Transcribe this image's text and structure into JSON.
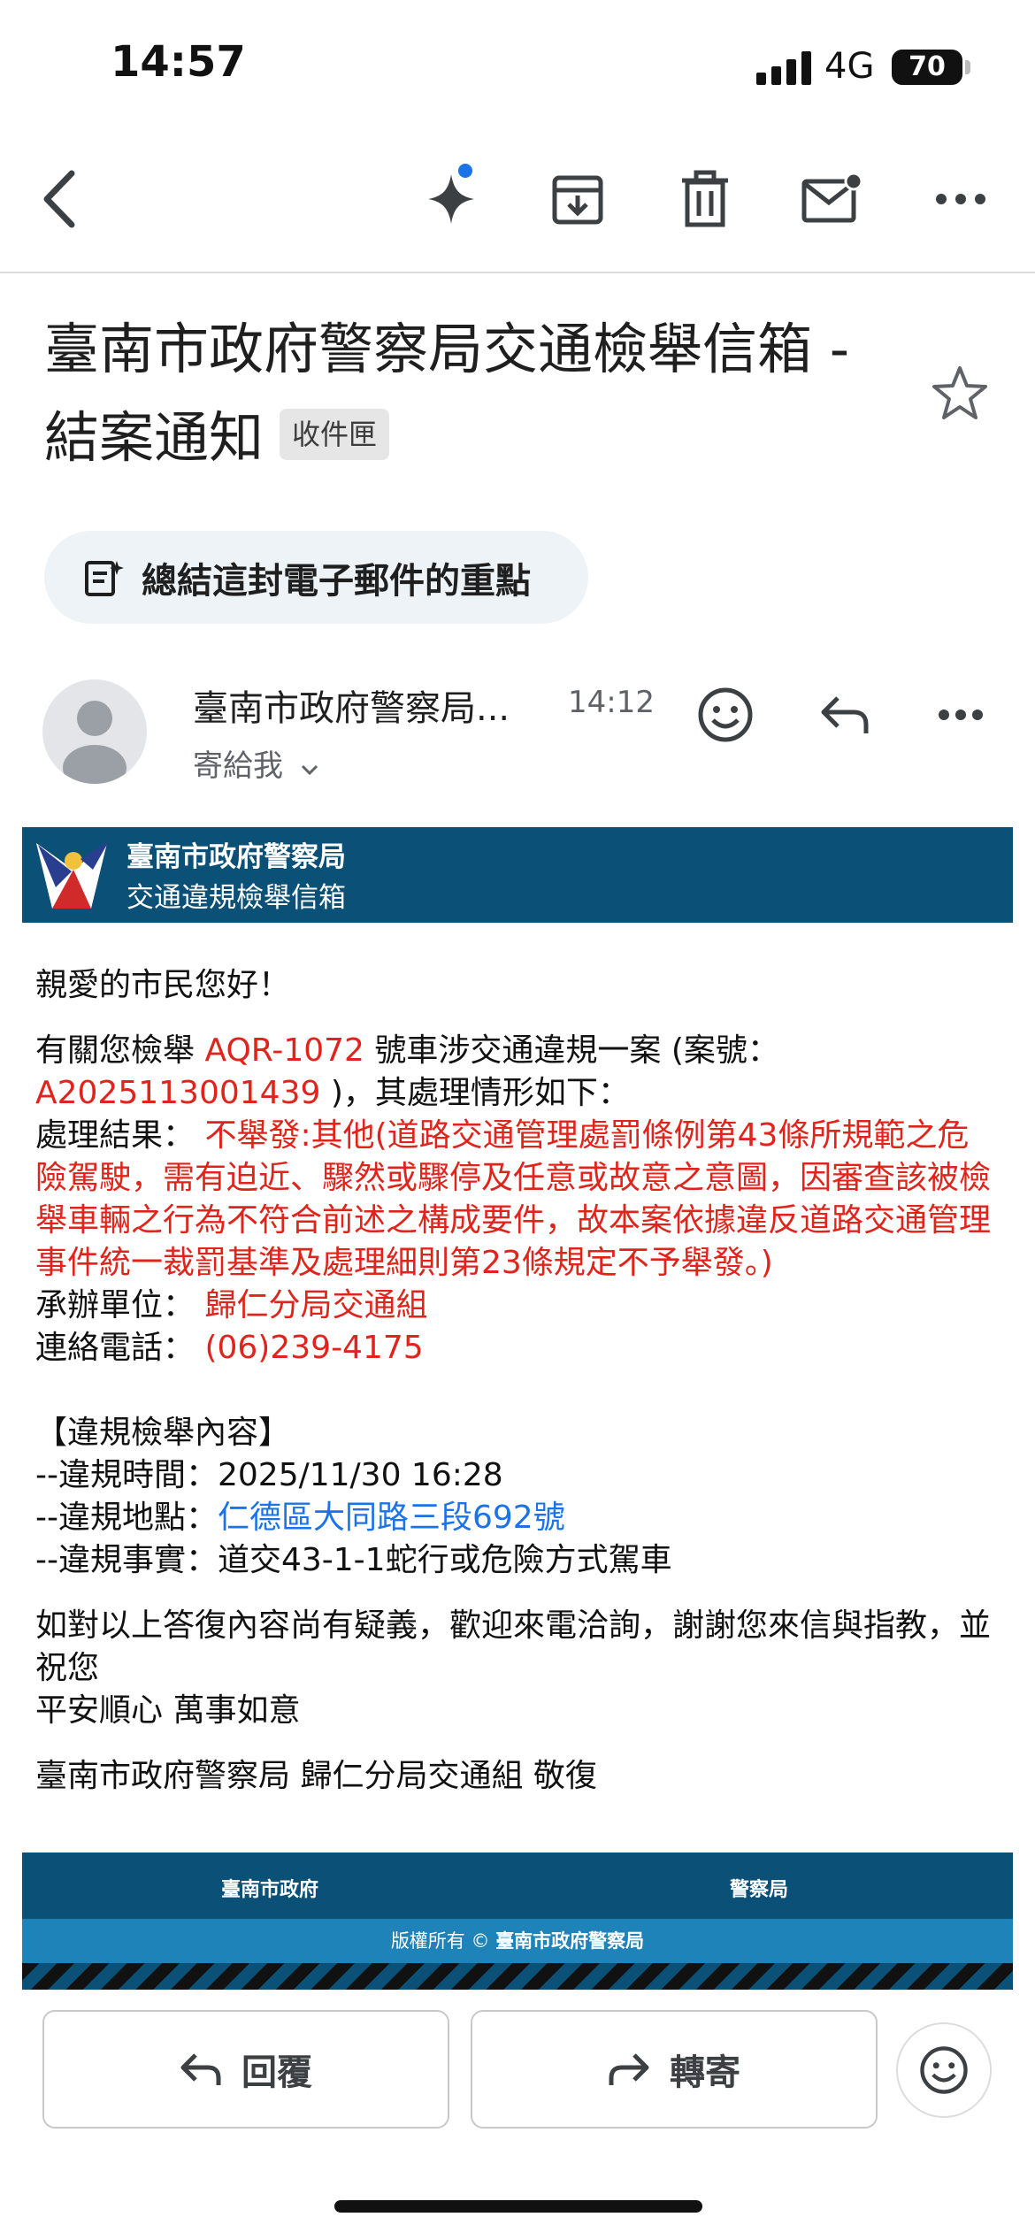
{
  "status_bar": {
    "time": "14:57",
    "network": "4G",
    "battery": "70"
  },
  "toolbar": {
    "icons": [
      "back-arrow-icon",
      "gemini-sparkle-icon",
      "archive-icon",
      "trash-icon",
      "mark-unread-icon",
      "more-options-icon"
    ]
  },
  "email": {
    "subject": "臺南市政府警察局交通檢舉信箱 - 結案通知",
    "label_chip": "收件匣",
    "summarize_label": "總結這封電子郵件的重點",
    "sender_name": "臺南市政府警察局...",
    "time": "14:12",
    "to_me": "寄給我"
  },
  "banner": {
    "line1": "臺南市政府警察局",
    "line2": "交通違規檢舉信箱"
  },
  "body": {
    "greeting": "親愛的市民您好！",
    "intro_1": "有關您檢舉 ",
    "plate": "AQR-1072",
    "intro_2": " 號車涉交通違規一案 (案號：",
    "case_no": "A2025113001439",
    "intro_3": " )，其處理情形如下：",
    "result_label": "處理結果： ",
    "result_value": "不舉發:其他(道路交通管理處罰條例第43條所規範之危險駕駛，需有迫近、驟然或驟停及任意或故意之意圖，因審查該被檢舉車輛之行為不符合前述之構成要件，故本案依據違反道路交通管理事件統一裁罰基準及處理細則第23條規定不予舉發。)",
    "unit_label": "承辦單位： ",
    "unit_value": "歸仁分局交通組",
    "phone_label": "連絡電話： ",
    "phone_value": "(06)239-4175",
    "section_title": "【違規檢舉內容】",
    "violation_time": "--違規時間：2025/11/30 16:28",
    "violation_place_label": "--違規地點：",
    "violation_place": "仁德區大同路三段692號",
    "violation_fact": "--違規事實：道交43-1-1蛇行或危險方式駕車",
    "closing_1": "如對以上答復內容尚有疑義，歡迎來電洽詢，謝謝您來信與指教，並祝您",
    "closing_2": "平安順心 萬事如意",
    "signature": "臺南市政府警察局 歸仁分局交通組 敬復"
  },
  "footer": {
    "left": "臺南市政府",
    "right": "警察局",
    "copyright_prefix": "版權所有 ©",
    "copyright_owner": "臺南市政府警察局"
  },
  "actions": {
    "reply": "回覆",
    "forward": "轉寄"
  },
  "colors": {
    "banner": "#0b5077",
    "footer_stripe": "#1e83b8",
    "red_text": "#e0241b",
    "link": "#1a73e8",
    "gemini_dot": "#1a73e8"
  }
}
